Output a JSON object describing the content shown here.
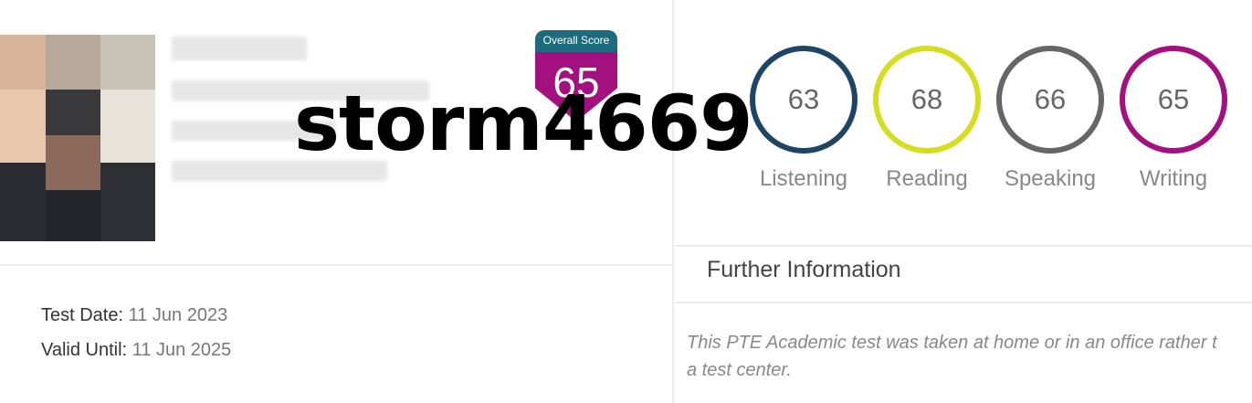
{
  "overall_score": {
    "label": "Overall Score",
    "value": "65",
    "colors": {
      "header": "#1d6b7d",
      "body": "#a2117f"
    }
  },
  "watermark": "storm4669",
  "test_info": {
    "test_date_label": "Test Date:",
    "test_date_value": "11 Jun 2023",
    "valid_until_label": "Valid Until:",
    "valid_until_value": "11 Jun 2025"
  },
  "skills": [
    {
      "name": "Listening",
      "score": "63",
      "color": "#1e4664"
    },
    {
      "name": "Reading",
      "score": "68",
      "color": "#d4dd1e"
    },
    {
      "name": "Speaking",
      "score": "66",
      "color": "#666666"
    },
    {
      "name": "Writing",
      "score": "65",
      "color": "#a2117f"
    }
  ],
  "further_information": {
    "title": "Further Information",
    "line1": "This PTE Academic test was taken at home or in an office rather t",
    "line2": "a test center."
  }
}
